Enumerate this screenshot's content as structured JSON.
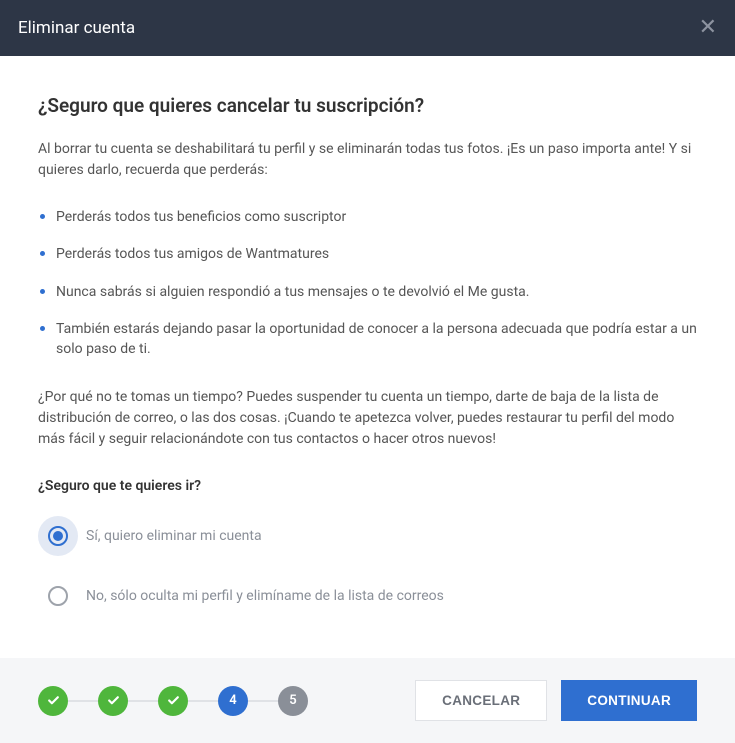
{
  "header": {
    "title": "Eliminar cuenta"
  },
  "content": {
    "heading": "¿Seguro que quieres cancelar tu suscripción?",
    "intro": "Al borrar tu cuenta se deshabilitará tu perfil y se eliminarán todas tus fotos. ¡Es un paso importa ante! Y si quieres darlo, recuerda que perderás:",
    "bullets": [
      "Perderás todos tus beneficios como suscriptor",
      "Perderás todos tus amigos de Wantmatures",
      "Nunca sabrás si alguien respondió a tus mensajes o te devolvió el Me gusta.",
      "También estarás dejando pasar la oportunidad de conocer a la persona adecuada que podría estar a un solo paso de ti."
    ],
    "mid_text": "¿Por qué no te tomas un tiempo? Puedes suspender tu cuenta un tiempo, darte de baja de la lista de distribución de correo, o las dos cosas. ¡Cuando te apetezca volver, puedes restaurar tu perfil del modo más fácil y seguir relacionándote con tus contactos o hacer otros nuevos!",
    "question": "¿Seguro que te quieres ir?",
    "options": [
      {
        "label": "Sí, quiero eliminar mi cuenta",
        "selected": true
      },
      {
        "label": "No, sólo oculta mi perfil y elimíname de la lista de correos",
        "selected": false
      }
    ]
  },
  "steps": {
    "items": [
      {
        "state": "done",
        "label": ""
      },
      {
        "state": "done",
        "label": ""
      },
      {
        "state": "done",
        "label": ""
      },
      {
        "state": "current",
        "label": "4"
      },
      {
        "state": "future",
        "label": "5"
      }
    ]
  },
  "buttons": {
    "cancel": "CANCELAR",
    "continue": "CONTINUAR"
  }
}
